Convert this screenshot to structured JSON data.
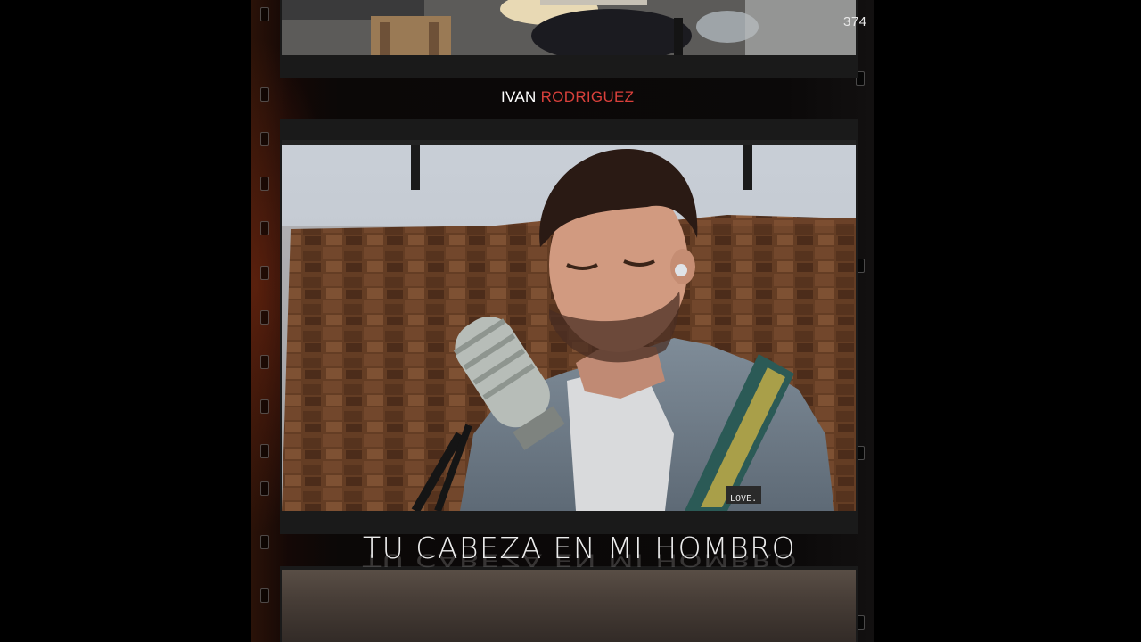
{
  "cover": {
    "frame_number": "374",
    "artist_first": "IVAN",
    "artist_last": "RODRIGUEZ",
    "song_title": "TU CABEZA EN MI HOMBRO",
    "strap_text": "LOVE."
  },
  "colors": {
    "background": "#000000",
    "accent": "#d9403b",
    "text": "#ececec"
  }
}
